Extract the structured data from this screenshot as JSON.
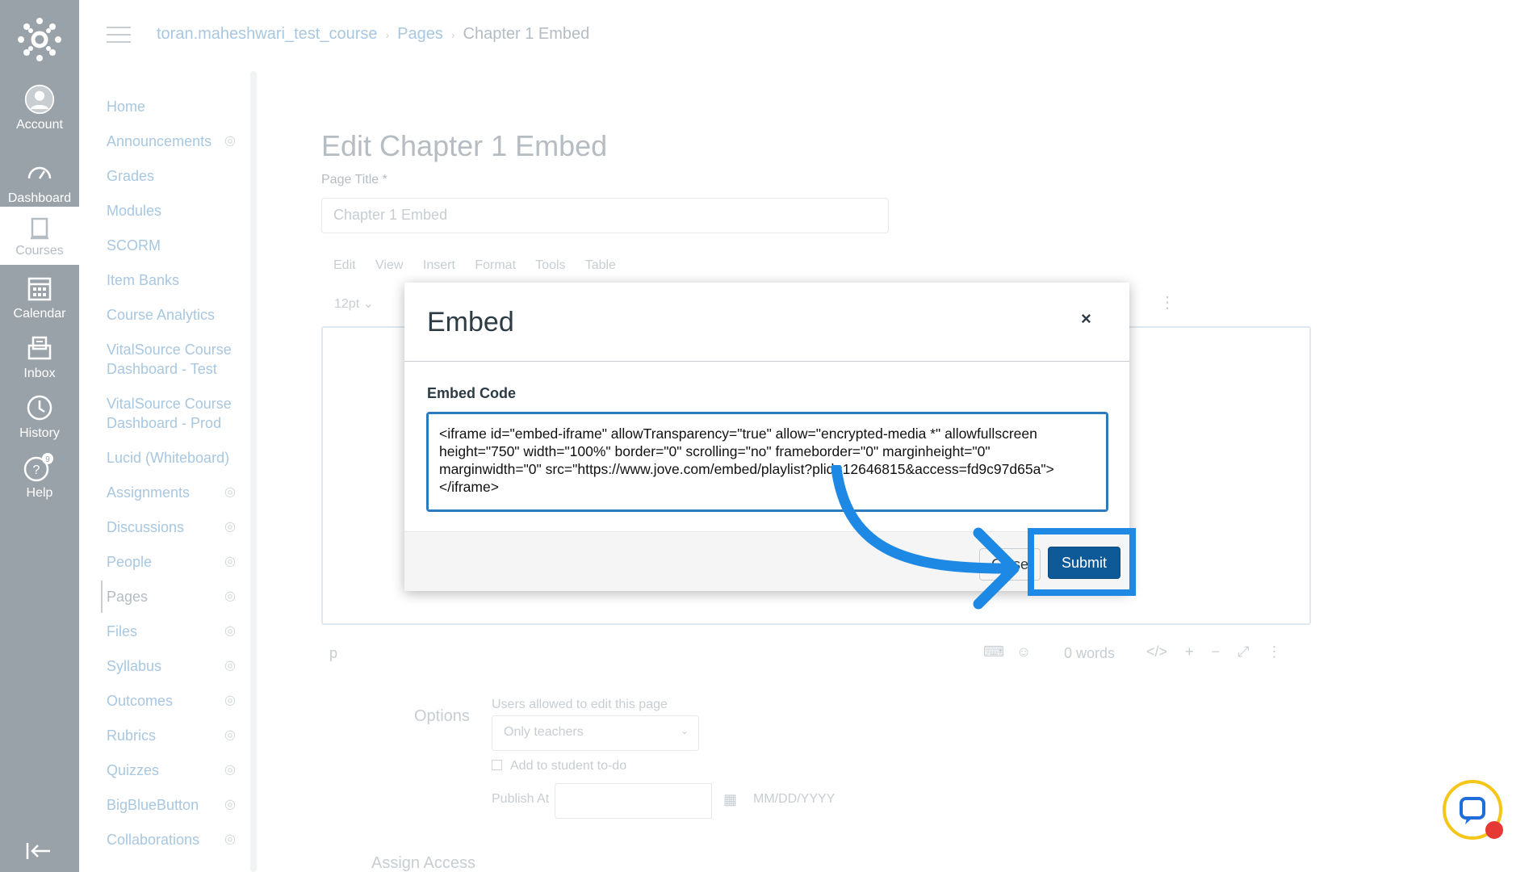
{
  "global_nav": {
    "items": [
      {
        "label": "Account",
        "icon": "account-icon"
      },
      {
        "label": "Dashboard",
        "icon": "dashboard-icon"
      },
      {
        "label": "Courses",
        "icon": "courses-icon"
      },
      {
        "label": "Calendar",
        "icon": "calendar-icon"
      },
      {
        "label": "Inbox",
        "icon": "inbox-icon"
      },
      {
        "label": "History",
        "icon": "history-icon"
      },
      {
        "label": "Help",
        "icon": "help-icon"
      }
    ],
    "help_badge": "9"
  },
  "breadcrumb": {
    "course": "toran.maheshwari_test_course",
    "section": "Pages",
    "current": "Chapter 1 Embed"
  },
  "course_nav": {
    "items": [
      {
        "label": "Home"
      },
      {
        "label": "Announcements"
      },
      {
        "label": "Grades"
      },
      {
        "label": "Modules"
      },
      {
        "label": "SCORM"
      },
      {
        "label": "Item Banks"
      },
      {
        "label": "Course Analytics"
      },
      {
        "label": "VitalSource Course Dashboard - Test"
      },
      {
        "label": "VitalSource Course Dashboard - Prod"
      },
      {
        "label": "Lucid (Whiteboard)"
      },
      {
        "label": "Assignments"
      },
      {
        "label": "Discussions"
      },
      {
        "label": "People"
      },
      {
        "label": "Pages"
      },
      {
        "label": "Files"
      },
      {
        "label": "Syllabus"
      },
      {
        "label": "Outcomes"
      },
      {
        "label": "Rubrics"
      },
      {
        "label": "Quizzes"
      },
      {
        "label": "BigBlueButton"
      },
      {
        "label": "Collaborations"
      }
    ]
  },
  "editor": {
    "heading": "Edit Chapter 1 Embed",
    "page_title_label": "Page Title",
    "page_title_required": "*",
    "page_title_value": "Chapter 1 Embed",
    "menu": [
      "Edit",
      "View",
      "Insert",
      "Format",
      "Tools",
      "Table"
    ],
    "font_size": "12pt",
    "status_tag": "p",
    "word_count": "0 words"
  },
  "options": {
    "label": "Options",
    "users_label": "Users allowed to edit this page",
    "users_value": "Only teachers",
    "todo_label": "Add to student to-do",
    "publish_label": "Publish At",
    "publish_placeholder": "MM/DD/YYYY",
    "assign_label": "Assign Access"
  },
  "modal": {
    "title": "Embed",
    "close_symbol": "×",
    "embed_label": "Embed Code",
    "embed_value": "<iframe id=\"embed-iframe\" allowTransparency=\"true\" allow=\"encrypted-media *\" allowfullscreen height=\"750\" width=\"100%\" border=\"0\" scrolling=\"no\" frameborder=\"0\" marginheight=\"0\" marginwidth=\"0\" src=\"https://www.jove.com/embed/playlist?plid=12646815&access=fd9c97d65a\"></iframe>",
    "close_button": "Close",
    "submit_button": "Submit"
  },
  "colors": {
    "nav_bg": "#9aa2a9",
    "submit_bg": "#0e5a99",
    "highlight": "#1e88e5",
    "chat_ring": "#f5c518",
    "chat_dot": "#e53935"
  }
}
